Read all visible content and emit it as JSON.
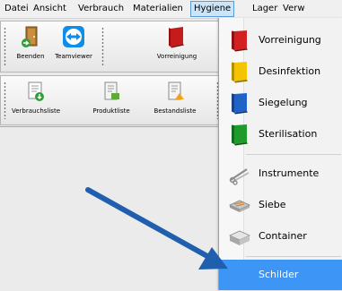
{
  "menubar": {
    "items": [
      "Datei",
      "Ansicht",
      "Verbrauch",
      "Materialien",
      "Hygiene",
      "Lager",
      "Verw"
    ],
    "active_index": 4
  },
  "toolbar_top": {
    "buttons": [
      {
        "label": "Beenden",
        "icon": "exit-door-icon"
      },
      {
        "label": "Teamviewer",
        "icon": "teamviewer-icon"
      },
      {
        "label": "Vorreinigung",
        "icon": "red-book-icon"
      }
    ]
  },
  "toolbar_bottom": {
    "buttons": [
      {
        "label": "Verbrauchsliste",
        "icon": "list-download-icon"
      },
      {
        "label": "Produktliste",
        "icon": "product-list-icon"
      },
      {
        "label": "Bestandsliste",
        "icon": "stock-list-icon"
      }
    ]
  },
  "hygiene_menu": {
    "items": [
      {
        "label": "Vorreinigung",
        "icon": "red-book-icon",
        "color": "#d32020"
      },
      {
        "label": "Desinfektion",
        "icon": "yellow-book-icon",
        "color": "#f5c400"
      },
      {
        "label": "Siegelung",
        "icon": "blue-book-icon",
        "color": "#1f63c9"
      },
      {
        "label": "Sterilisation",
        "icon": "green-book-icon",
        "color": "#1e9b2a"
      },
      {
        "label": "Instrumente",
        "icon": "instruments-icon"
      },
      {
        "label": "Siebe",
        "icon": "tray-icon"
      },
      {
        "label": "Container",
        "icon": "container-icon"
      },
      {
        "label": "Schilder",
        "icon": "",
        "highlighted": true
      }
    ]
  },
  "colors": {
    "highlight": "#3d95f5",
    "arrow": "#1f5fae"
  }
}
